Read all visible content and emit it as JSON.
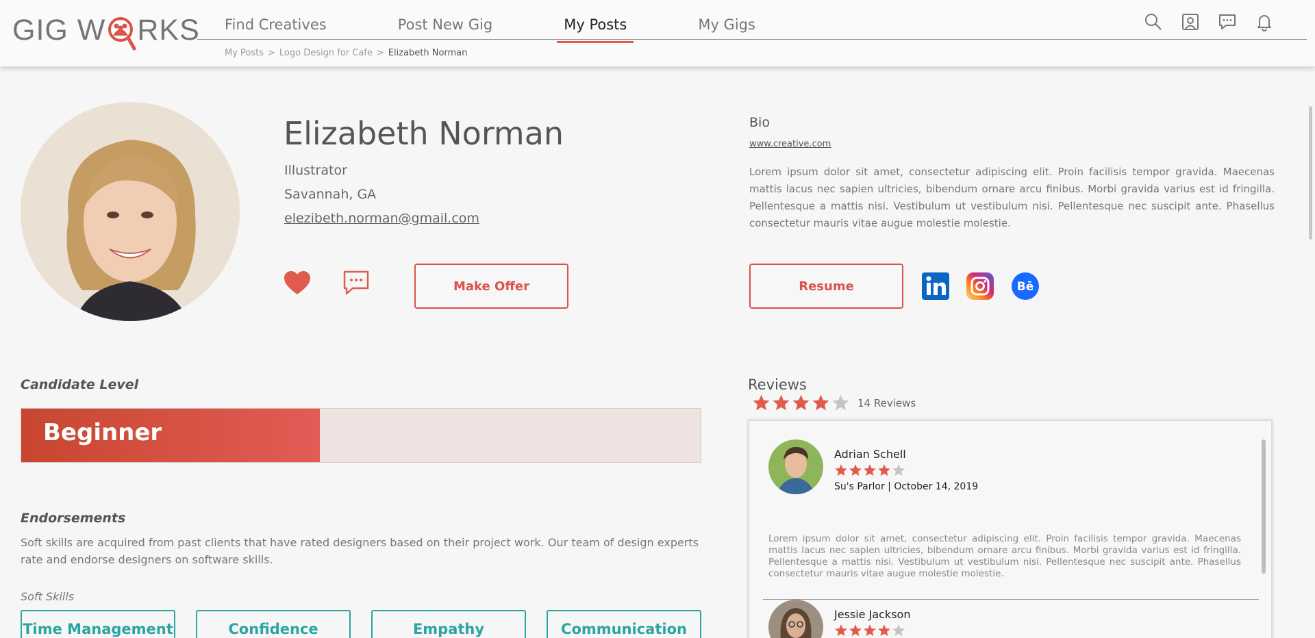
{
  "app": {
    "logo_left": "GIG W",
    "logo_right": "RKS"
  },
  "nav": {
    "items": [
      "Find Creatives",
      "Post New Gig",
      "My Posts",
      "My Gigs"
    ],
    "active": "My Posts"
  },
  "breadcrumb": {
    "items": [
      "My Posts",
      ">",
      "Logo Design for Cafe",
      ">"
    ],
    "current": "Elizabeth Norman"
  },
  "header_icons": [
    "search-icon",
    "profile-icon",
    "messages-icon",
    "notifications-icon"
  ],
  "profile": {
    "name": "Elizabeth Norman",
    "role": "Illustrator",
    "location": "Savannah, GA",
    "email": "elezibeth.norman@gmail.com",
    "make_offer_label": "Make Offer"
  },
  "bio": {
    "title": "Bio",
    "link": "www.creative.com",
    "text": "Lorem ipsum dolor sit amet, consectetur adipiscing elit. Proin facilisis tempor gravida. Maecenas mattis lacus nec sapien ultricies, bibendum ornare arcu finibus. Morbi gravida varius est id fringilla. Pellentesque a mattis nisi. Vestibulum ut vestibulum nisi. Pellentesque nec suscipit ante. Phasellus consectetur mauris vitae augue molestie molestie.",
    "resume_label": "Resume",
    "social": [
      "linkedin-icon",
      "instagram-icon",
      "behance-icon"
    ]
  },
  "candidate_level": {
    "title": "Candidate Level",
    "label": "Beginner",
    "fraction": 0.44
  },
  "endorsements": {
    "title": "Endorsements",
    "text": "Soft skills are acquired from past clients that have rated designers based on their project work. Our team of design experts rate and endorse designers on software skills.",
    "soft_skills_label": "Soft Skills",
    "skills": [
      "Time Management",
      "Confidence",
      "Empathy",
      "Communication"
    ]
  },
  "reviews": {
    "title": "Reviews",
    "rating": 4,
    "count_label": "14 Reviews",
    "items": [
      {
        "name": "Adrian Schell",
        "rating": 4,
        "meta": "Su's Parlor | October 14, 2019",
        "text": "Lorem ipsum dolor sit amet, consectetur adipiscing elit. Proin facilisis tempor gravida. Maecenas mattis lacus nec sapien ultricies, bibendum ornare arcu finibus. Morbi gravida varius est id fringilla. Pellentesque a mattis nisi. Vestibulum ut vestibulum nisi. Pellentesque nec suscipit ante. Phasellus consectetur mauris vitae augue molestie molestie."
      },
      {
        "name": "Jessie Jackson",
        "rating": 4,
        "meta": "",
        "text": ""
      }
    ]
  },
  "colors": {
    "accent": "#d9534a",
    "teal": "#2aa5a2",
    "star_on": "#e05a4e",
    "star_off": "#c4c4c4"
  }
}
